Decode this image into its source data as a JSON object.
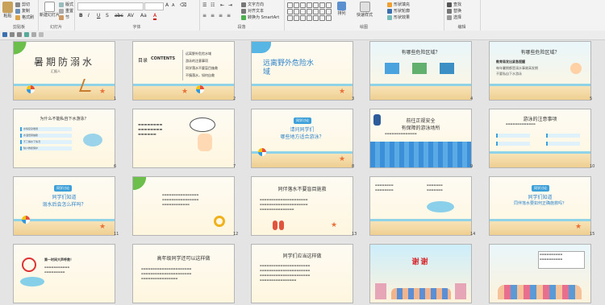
{
  "ribbon": {
    "clipboard": {
      "paste": "粘贴",
      "cut": "剪切",
      "copy": "复制",
      "format_painter": "格式刷",
      "label": "剪贴板"
    },
    "slides": {
      "new_slide": "新建幻灯片",
      "layout": "版式",
      "reset": "重置",
      "section": "节",
      "label": "幻灯片"
    },
    "font": {
      "label": "字体",
      "format_buttons": [
        "B",
        "I",
        "U",
        "S",
        "abc",
        "AV",
        "Aa",
        "A"
      ]
    },
    "paragraph": {
      "text_direction": "文字方向",
      "align_text": "对齐文本",
      "smartart": "转换为 SmartArt",
      "label": "段落"
    },
    "drawing": {
      "arrange": "排列",
      "quick_styles": "快速样式",
      "shape_fill": "形状填充",
      "shape_outline": "形状轮廓",
      "shape_effects": "形状效果",
      "label": "绘图"
    },
    "editing": {
      "find": "查找",
      "replace": "替换",
      "select": "选择",
      "label": "编辑"
    }
  },
  "slides": [
    {
      "n": 1,
      "title": "暑期防溺水",
      "subtitle": "汇报人"
    },
    {
      "n": 2,
      "title": "目录",
      "title_en": "CONTENTS",
      "items": [
        "远离野外危险水域",
        "游泳的注意事项",
        "同学落水不要盲目施救",
        "不慎落水，如何自救"
      ]
    },
    {
      "n": 3,
      "title": "远离野外危险水域"
    },
    {
      "n": 4,
      "title": "有哪些危险区域？"
    },
    {
      "n": 5,
      "title": "有哪些危险区域？",
      "lines": [
        "教育局发出紧急提醒",
        "每年暑期都是溺水事故高发期",
        "不要私自下水游泳"
      ]
    },
    {
      "n": 6,
      "title": "为什么不能私自下水游泳？",
      "items": [
        "水情复杂难测",
        "水温低易抽筋",
        "不了解水下情况",
        "缺少救援保护"
      ]
    },
    {
      "n": 7,
      "title": ""
    },
    {
      "n": 8,
      "chip": "同学讨论",
      "title": "请问同学们",
      "title2": "哪些地方适合游泳？"
    },
    {
      "n": 9,
      "title": "前往正规安全",
      "title2": "有保障的游泳场所"
    },
    {
      "n": 10,
      "title": "游泳的注意事项"
    },
    {
      "n": 11,
      "chip": "同学讨论",
      "title": "同学们知道",
      "title2": "溺水后会怎么样吗？"
    },
    {
      "n": 12,
      "title": ""
    },
    {
      "n": 13,
      "title": "同伴落水不要盲目施救"
    },
    {
      "n": 14,
      "title": ""
    },
    {
      "n": 15,
      "chip": "同学讨论",
      "title": "同学们知道",
      "title2": "同伴落水要如何正确施救吗？"
    },
    {
      "n": 16,
      "title": "第一时间大声呼救！"
    },
    {
      "n": 17,
      "title": "高年级同学还可以这样做"
    },
    {
      "n": 18,
      "title": "同学们应当这样做"
    },
    {
      "n": 19,
      "title": "谢谢"
    },
    {
      "n": 20,
      "title": ""
    }
  ]
}
